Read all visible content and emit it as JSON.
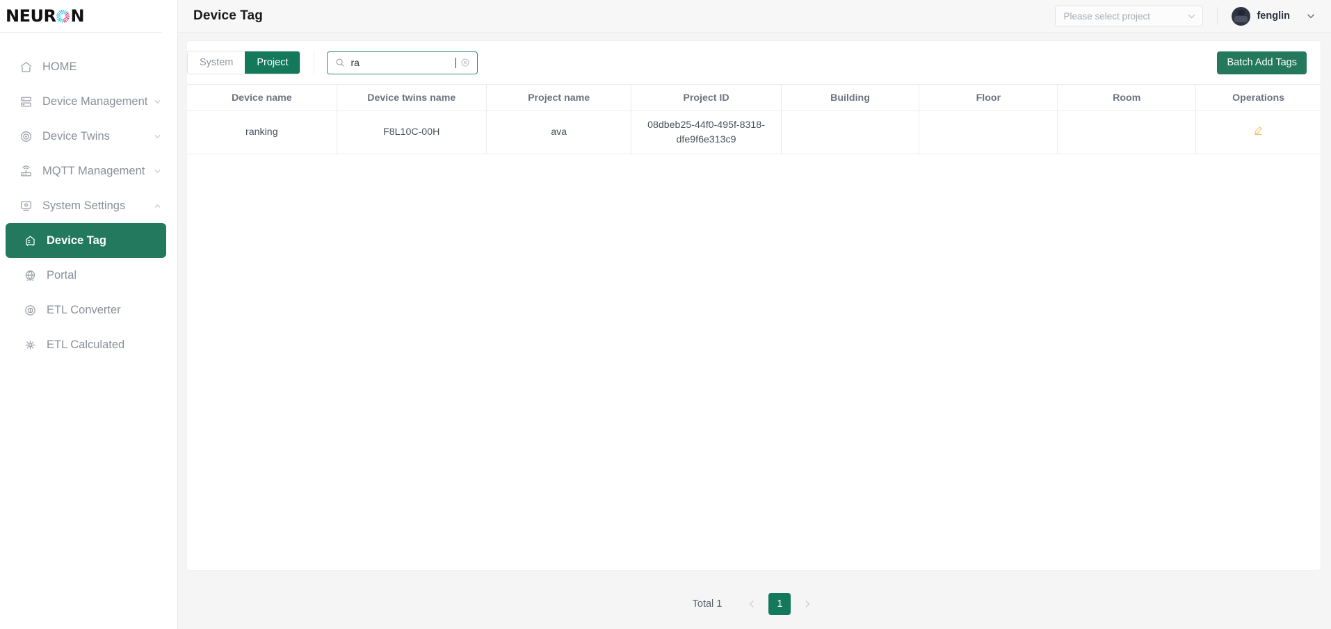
{
  "brand": {
    "logo_left": "NEUR",
    "logo_right": "N",
    "logo_icon": "neuron-circle-icon"
  },
  "sidebar": {
    "items": [
      {
        "label": "HOME",
        "icon": "home-icon",
        "chevron": "",
        "level": "top",
        "active": false
      },
      {
        "label": "Device Management",
        "icon": "server-icon",
        "chevron": "down",
        "level": "top",
        "active": false
      },
      {
        "label": "Device Twins",
        "icon": "target-icon",
        "chevron": "down",
        "level": "top",
        "active": false
      },
      {
        "label": "MQTT Management",
        "icon": "router-icon",
        "chevron": "down",
        "level": "top",
        "active": false
      },
      {
        "label": "System Settings",
        "icon": "monitor-icon",
        "chevron": "up",
        "level": "top",
        "active": false
      },
      {
        "label": "Device Tag",
        "icon": "tag-truck-icon",
        "chevron": "",
        "level": "sub",
        "active": true
      },
      {
        "label": "Portal",
        "icon": "globe-icon",
        "chevron": "",
        "level": "sub",
        "active": false
      },
      {
        "label": "ETL Converter",
        "icon": "converter-icon",
        "chevron": "",
        "level": "sub",
        "active": false
      },
      {
        "label": "ETL Calculated",
        "icon": "calculated-icon",
        "chevron": "",
        "level": "sub",
        "active": false
      }
    ]
  },
  "header": {
    "title": "Device Tag",
    "project_select": {
      "placeholder": "Please select project",
      "value": "",
      "chevron_icon": "chevron-down-icon"
    },
    "user": {
      "name": "fenglin",
      "avatar_icon": "user-avatar",
      "chevron_icon": "chevron-down-icon"
    }
  },
  "toolbar": {
    "tabs": [
      {
        "label": "System",
        "active": false
      },
      {
        "label": "Project",
        "active": true
      }
    ],
    "search": {
      "value": "ra",
      "placeholder": "",
      "search_icon": "search-icon",
      "clear_icon": "clear-circle-icon"
    },
    "batch_add_label": "Batch Add Tags"
  },
  "table": {
    "columns": [
      "Device name",
      "Device twins name",
      "Project name",
      "Project ID",
      "Building",
      "Floor",
      "Room",
      "Operations"
    ],
    "rows": [
      {
        "device_name": "ranking",
        "device_twins_name": "F8L10C-00H",
        "project_name": "ava",
        "project_id": "08dbeb25-44f0-495f-8318-dfe9f6e313c9",
        "building": "",
        "floor": "",
        "room": "",
        "operations_icon": "edit-pencil-icon"
      }
    ]
  },
  "pagination": {
    "total_label": "Total 1",
    "prev_icon": "chevron-left-icon",
    "next_icon": "chevron-right-icon",
    "pages": [
      "1"
    ],
    "current": "1"
  },
  "colors": {
    "accent_green": "#14795a",
    "active_nav_green": "#22795d",
    "edit_icon": "#f2c166",
    "page_bg": "#f5f5f5"
  }
}
